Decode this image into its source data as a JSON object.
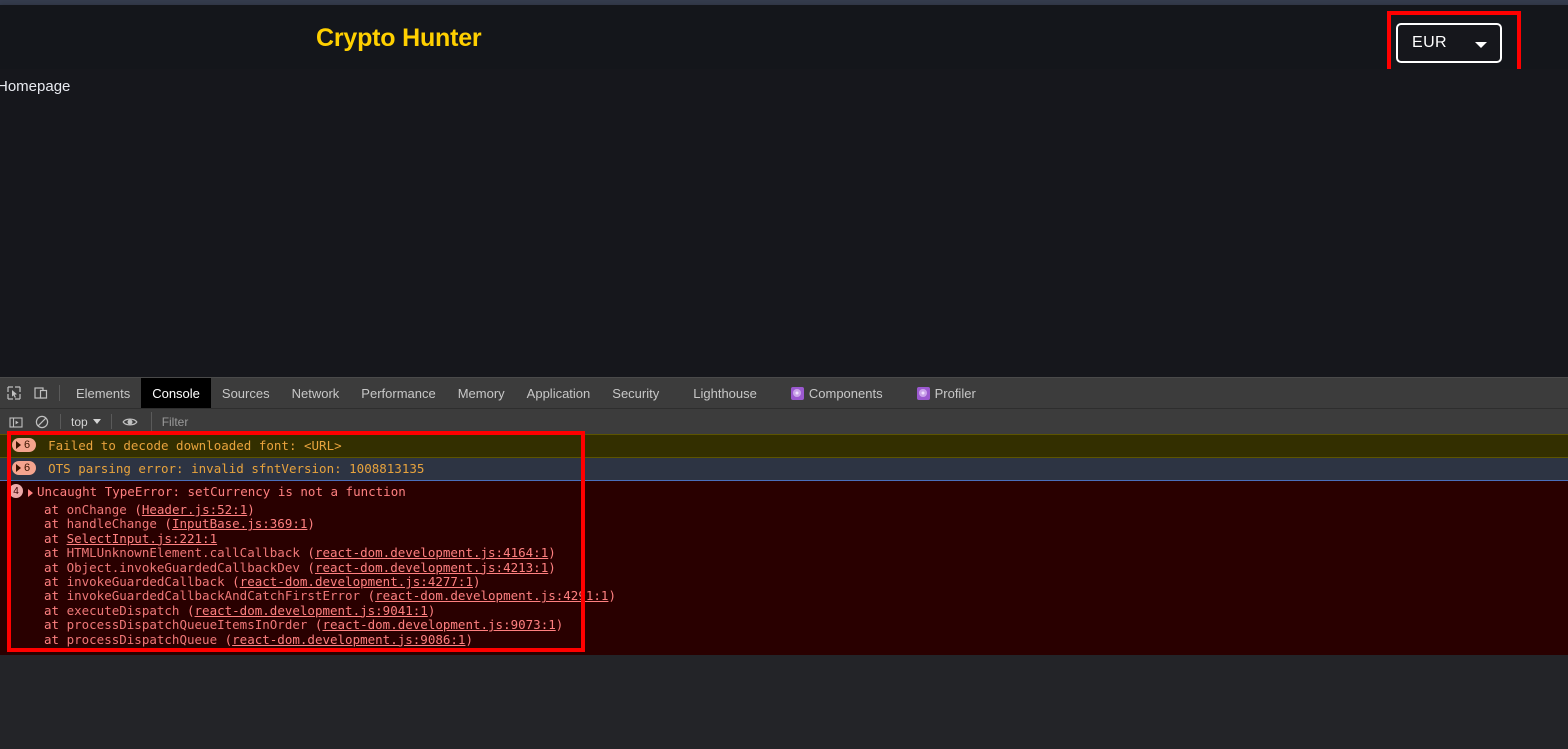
{
  "page": {
    "app_title": "Crypto Hunter",
    "title_color": "#ffd000",
    "nav_link": "Homepage",
    "currency": {
      "value": "EUR",
      "icon": "chevron-down-icon"
    },
    "annotation_color": "#ff0000"
  },
  "devtools": {
    "tabs": [
      {
        "label": "Elements",
        "active": false,
        "icon": null
      },
      {
        "label": "Console",
        "active": true,
        "icon": null
      },
      {
        "label": "Sources",
        "active": false,
        "icon": null
      },
      {
        "label": "Network",
        "active": false,
        "icon": null
      },
      {
        "label": "Performance",
        "active": false,
        "icon": null
      },
      {
        "label": "Memory",
        "active": false,
        "icon": null
      },
      {
        "label": "Application",
        "active": false,
        "icon": null
      },
      {
        "label": "Security",
        "active": false,
        "icon": null
      },
      {
        "label": "Lighthouse",
        "active": false,
        "icon": null
      },
      {
        "label": "Components",
        "active": false,
        "icon": "react-icon"
      },
      {
        "label": "Profiler",
        "active": false,
        "icon": "react-icon"
      }
    ],
    "toolbar_icons": [
      "inspect-element-icon",
      "device-toolbar-icon"
    ],
    "console_toolbar": {
      "sidebar_icon": "console-sidebar-icon",
      "clear_icon": "clear-console-icon",
      "context": "top",
      "context_caret": "chevron-down-icon",
      "eye_icon": "live-expression-icon",
      "filter_placeholder": "Filter",
      "filter_value": ""
    }
  },
  "console_messages": [
    {
      "type": "warning",
      "badge": "6",
      "badge_style": "pill",
      "text": "Failed to decode downloaded font: <URL>"
    },
    {
      "type": "info",
      "badge": "6",
      "badge_style": "pill",
      "text": "OTS parsing error: invalid sfntVersion: 1008813135"
    },
    {
      "type": "error",
      "badge": "4",
      "badge_style": "circle",
      "text": "Uncaught TypeError: setCurrency is not a function",
      "stack": [
        {
          "at": "at ",
          "fn": "onChange",
          "open": " (",
          "src": "Header.js:52:1",
          "close": ")"
        },
        {
          "at": "at ",
          "fn": "handleChange",
          "open": " (",
          "src": "InputBase.js:369:1",
          "close": ")"
        },
        {
          "at": "at ",
          "fn": "",
          "open": "",
          "src": "SelectInput.js:221:1",
          "close": ""
        },
        {
          "at": "at ",
          "fn": "HTMLUnknownElement.callCallback",
          "open": " (",
          "src": "react-dom.development.js:4164:1",
          "close": ")"
        },
        {
          "at": "at ",
          "fn": "Object.invokeGuardedCallbackDev",
          "open": " (",
          "src": "react-dom.development.js:4213:1",
          "close": ")"
        },
        {
          "at": "at ",
          "fn": "invokeGuardedCallback",
          "open": " (",
          "src": "react-dom.development.js:4277:1",
          "close": ")"
        },
        {
          "at": "at ",
          "fn": "invokeGuardedCallbackAndCatchFirstError",
          "open": " (",
          "src": "react-dom.development.js:4291:1",
          "close": ")"
        },
        {
          "at": "at ",
          "fn": "executeDispatch",
          "open": " (",
          "src": "react-dom.development.js:9041:1",
          "close": ")"
        },
        {
          "at": "at ",
          "fn": "processDispatchQueueItemsInOrder",
          "open": " (",
          "src": "react-dom.development.js:9073:1",
          "close": ")"
        },
        {
          "at": "at ",
          "fn": "processDispatchQueue",
          "open": " (",
          "src": "react-dom.development.js:9086:1",
          "close": ")"
        }
      ]
    }
  ]
}
